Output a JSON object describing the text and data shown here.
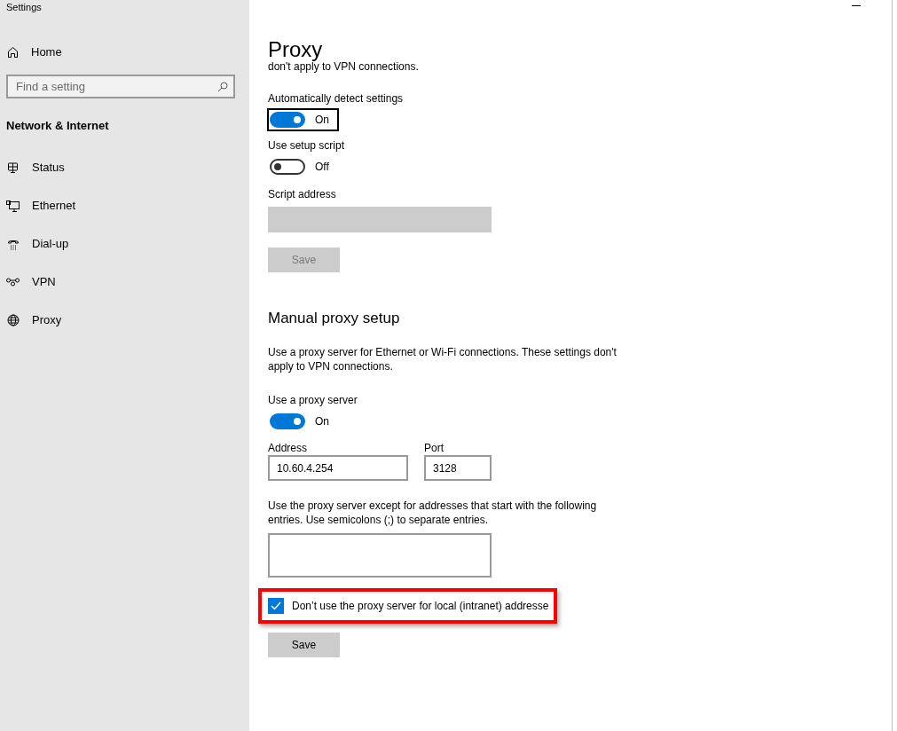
{
  "window": {
    "title": "Settings"
  },
  "sidebar": {
    "home": "Home",
    "search": {
      "placeholder": "Find a setting"
    },
    "section": "Network & Internet",
    "items": [
      {
        "label": "Status",
        "kind": "status"
      },
      {
        "label": "Ethernet",
        "kind": "ethernet"
      },
      {
        "label": "Dial-up",
        "kind": "dialup"
      },
      {
        "label": "VPN",
        "kind": "vpn"
      },
      {
        "label": "Proxy",
        "kind": "proxy"
      }
    ]
  },
  "page": {
    "title": "Proxy",
    "clipped_text": "don't apply to VPN connections.",
    "automatic": {
      "toggles": [
        {
          "label": "Automatically detect settings",
          "on": true,
          "state_text": "On",
          "focused": true
        },
        {
          "label": "Use setup script",
          "on": false,
          "state_text": "Off",
          "focused": false
        }
      ],
      "script_address": {
        "label": "Script address",
        "disabled": true
      },
      "save": {
        "label": "Save",
        "disabled": true
      }
    },
    "manual": {
      "heading": "Manual proxy setup",
      "description": "Use a proxy server for Ethernet or Wi-Fi connections. These settings don't apply to VPN connections.",
      "toggle": {
        "label": "Use a proxy server",
        "on": true,
        "state_text": "On",
        "focused": false
      },
      "address": {
        "label": "Address",
        "value": "10.60.4.254"
      },
      "port": {
        "label": "Port",
        "value": "3128"
      },
      "exceptions": {
        "description": "Use the proxy server except for addresses that start with the following entries. Use semicolons (;) to separate entries."
      },
      "local_bypass": {
        "label": "Don’t use the proxy server for local (intranet) addresse",
        "checked": true,
        "highlighted": true
      },
      "save": {
        "label": "Save",
        "disabled": false
      }
    }
  }
}
